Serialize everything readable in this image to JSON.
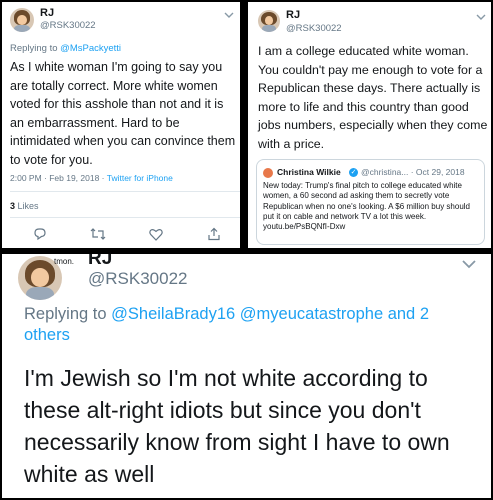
{
  "tweet1": {
    "name": "RJ",
    "handle": "@RSK30022",
    "reply_prefix": "Replying to ",
    "reply_to": "@MsPackyetti",
    "text": "As I white woman I'm going to say you are totally correct.  More white women voted for this asshole than not and it is an embarrassment.  Hard to be intimidated when you can convince them to vote for you.",
    "time": "2:00 PM · Feb 19, 2018 · ",
    "source": "Twitter for iPhone",
    "likes_count": "3",
    "likes_label": " Likes",
    "icons": [
      "reply-icon",
      "retweet-icon",
      "like-icon",
      "share-icon"
    ]
  },
  "tweet2": {
    "name": "RJ",
    "handle": "@RSK30022",
    "text": "I am a college educated white woman.  You couldn't pay me enough to vote for a Republican these days. There actually is more to life and this country than good jobs numbers, especially when they come with a price.",
    "quote": {
      "name": "Christina Wilkie",
      "handle": "@christina... · Oct 29, 2018",
      "text": "New today: Trump's final pitch to college educated white women, a 60 second ad asking them to secretly vote Republican when no one's looking. A $6 million buy should put it on cable and network TV a lot this week. youtu.be/PsBQNfI-Dxw"
    }
  },
  "tweet3": {
    "name": "RJ",
    "handle": "@RSK30022",
    "avatar_text": "tmon.",
    "reply_prefix": "Replying to ",
    "reply_to": "@SheilaBrady16 @myeucatastrophe and 2 others",
    "text": "I'm Jewish so I'm not white according to these alt-right idiots but since you don't necessarily know from sight I have to own white as well"
  },
  "colors": {
    "link": "#1da1f2",
    "secondary_text": "#657786",
    "primary_text": "#14171a"
  }
}
